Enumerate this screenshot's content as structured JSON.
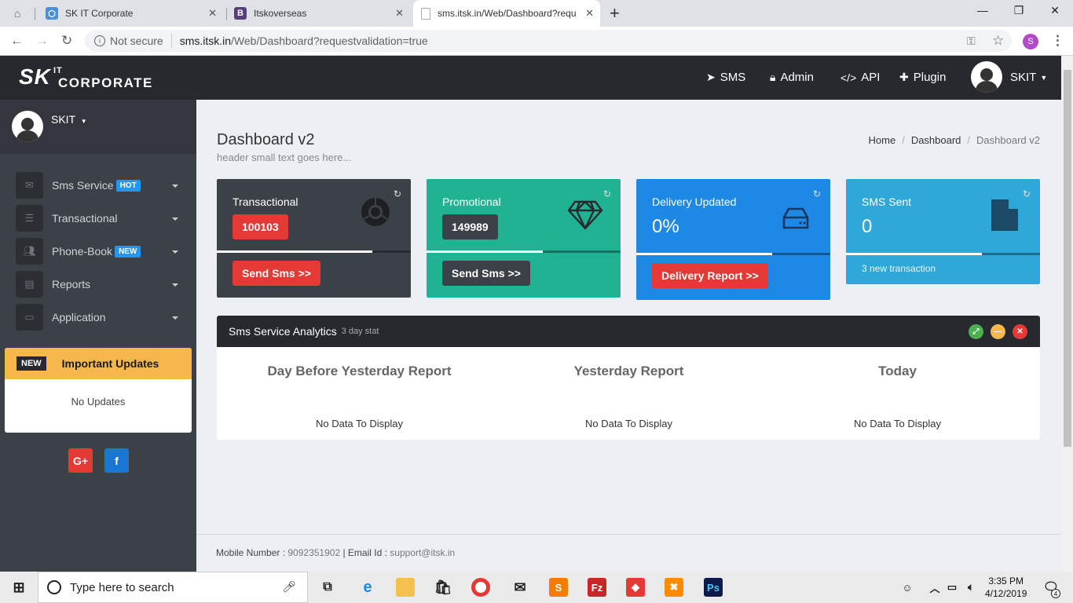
{
  "browser": {
    "tabs": [
      {
        "label": "SK IT Corporate"
      },
      {
        "label": "Itskoverseas"
      },
      {
        "label": "sms.itsk.in/Web/Dashboard?requ"
      }
    ],
    "new_tab": "+",
    "security": "Not secure",
    "url_domain": "sms.itsk.in",
    "url_path": "/Web/Dashboard?requestvalidation=true",
    "profile_initial": "S"
  },
  "header": {
    "logo_sk": "SK",
    "logo_it": "IT",
    "logo_corp": "CORPORATE",
    "nav": [
      {
        "label": "SMS",
        "icon": "paper-plane-icon"
      },
      {
        "label": "Admin",
        "icon": "lock-icon"
      },
      {
        "label": "API",
        "icon": "code-icon"
      },
      {
        "label": "Plugin",
        "icon": "puzzle-icon"
      }
    ],
    "user": "SKIT"
  },
  "sidebar": {
    "user": "SKIT",
    "menu": [
      {
        "label": "Sms Service",
        "badge": "HOT",
        "badge_color": "#2196f3",
        "icon": "envelope-icon"
      },
      {
        "label": "Transactional",
        "badge": "",
        "icon": "list-icon"
      },
      {
        "label": "Phone-Book",
        "badge": "NEW",
        "badge_color": "#2196f3",
        "icon": "users-icon"
      },
      {
        "label": "Reports",
        "badge": "",
        "icon": "table-icon"
      },
      {
        "label": "Application",
        "badge": "",
        "icon": "laptop-icon"
      }
    ],
    "updates": {
      "badge": "NEW",
      "title": "Important Updates",
      "body": "No Updates"
    },
    "social": [
      {
        "label": "G+",
        "color": "#e53935"
      },
      {
        "label": "f",
        "color": "#1976d2"
      }
    ]
  },
  "page": {
    "title": "Dashboard v2",
    "subtitle": "header small text goes here...",
    "breadcrumb": [
      "Home",
      "Dashboard",
      "Dashboard v2"
    ]
  },
  "cards": [
    {
      "title": "Transactional",
      "value": "100103",
      "button": "Send Sms >>",
      "icon": "chrome-icon",
      "bg": "#3c4148",
      "progress": 0.8
    },
    {
      "title": "Promotional",
      "value": "149989",
      "button": "Send Sms >>",
      "icon": "diamond-icon",
      "bg": "#1fb393",
      "progress": 0.6
    },
    {
      "title": "Delivery Updated",
      "value": "0%",
      "button": "Delivery Report >>",
      "icon": "hdd-icon",
      "bg": "#1e88e5",
      "progress": 0.7
    },
    {
      "title": "SMS Sent",
      "value": "0",
      "footer": "3 new transaction",
      "icon": "file-icon",
      "bg": "#2ea8d8",
      "progress": 0.7
    }
  ],
  "analytics": {
    "title": "Sms Service Analytics",
    "subtitle": "3 day stat",
    "columns": [
      {
        "heading": "Day Before Yesterday Report",
        "body": "No Data To Display"
      },
      {
        "heading": "Yesterday Report",
        "body": "No Data To Display"
      },
      {
        "heading": "Today",
        "body": "No Data To Display"
      }
    ]
  },
  "footer": {
    "mobile_label": "Mobile Number :",
    "mobile": "9092351902",
    "email_label": "| Email Id :",
    "email": "support@itsk.in"
  },
  "taskbar": {
    "search_placeholder": "Type here to search",
    "time": "3:35 PM",
    "date": "4/12/2019",
    "notifications": "4"
  }
}
